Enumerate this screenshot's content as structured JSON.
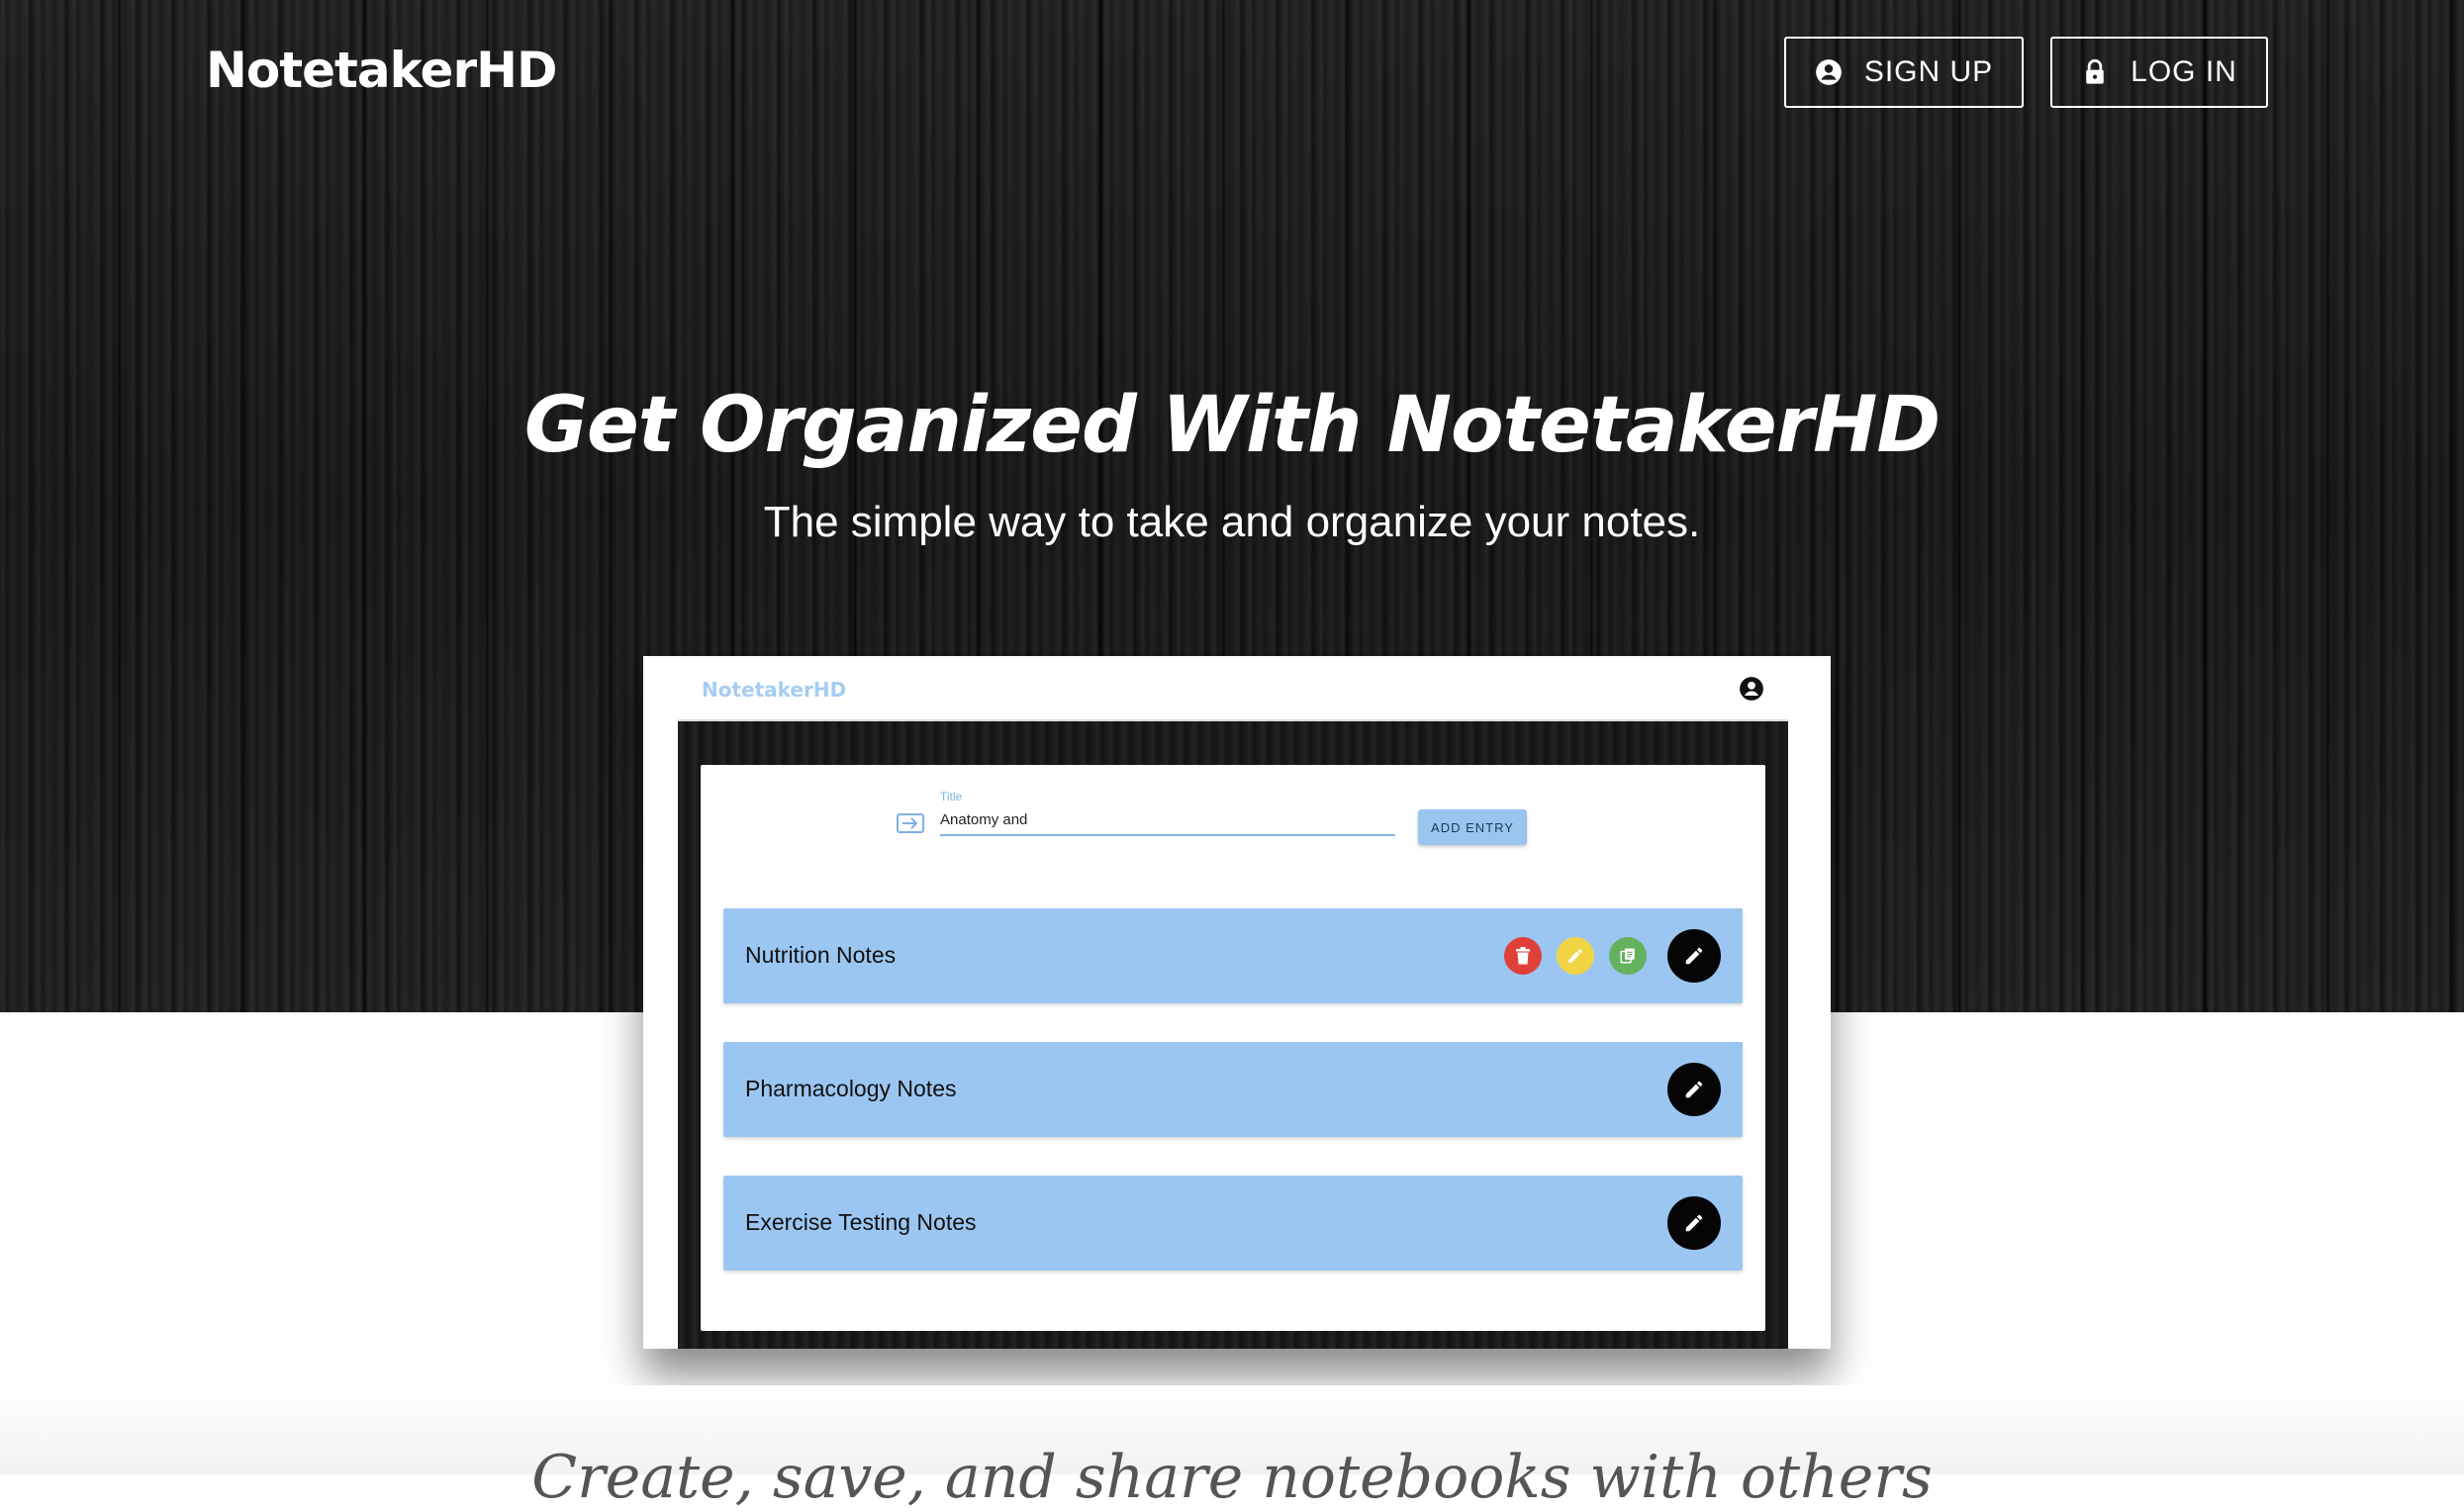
{
  "header": {
    "logo": "NotetakerHD",
    "signup_label": "SIGN UP",
    "login_label": "LOG IN"
  },
  "hero": {
    "title": "Get Organized With NotetakerHD",
    "subtitle": "The simple way to take and organize your notes."
  },
  "mockup": {
    "logo": "NotetakerHD",
    "title_label": "Title",
    "title_value": "Anatomy and",
    "add_entry_label": "ADD ENTRY",
    "notes": [
      {
        "title": "Nutrition Notes"
      },
      {
        "title": "Pharmacology Notes"
      },
      {
        "title": "Exercise Testing Notes"
      }
    ]
  },
  "bottom": {
    "text": "Create, save, and share notebooks with others"
  },
  "colors": {
    "note_row": "#9bc6f1",
    "delete": "#e0403a",
    "rename": "#f1d443",
    "copy": "#64b15e",
    "fab": "#050505"
  },
  "icons": {
    "signup": "account-circle-icon",
    "login": "lock-icon",
    "account": "account-circle-icon",
    "entry": "input-icon",
    "delete": "trash-icon",
    "rename": "pencil-icon",
    "copy": "copy-icon",
    "edit": "pencil-icon"
  }
}
